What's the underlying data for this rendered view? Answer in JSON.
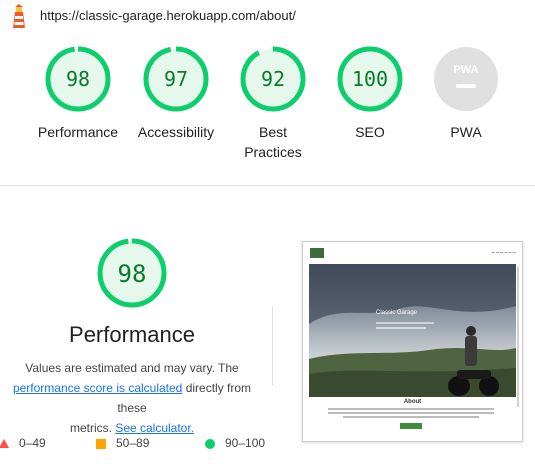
{
  "url": "https://classic-garage.herokuapp.com/about/",
  "gauges": [
    {
      "score": "98",
      "label": "Performance",
      "value": 98
    },
    {
      "score": "97",
      "label": "Accessibility",
      "value": 97
    },
    {
      "score": "92",
      "label": "Best Practices",
      "value": 92
    },
    {
      "score": "100",
      "label": "SEO",
      "value": 100
    },
    {
      "label": "PWA",
      "badge": "PWA"
    }
  ],
  "performance": {
    "score": "98",
    "title": "Performance",
    "desc_part1": "Values are estimated and may vary. The",
    "desc_link1": "performance score is calculated",
    "desc_part2": " directly from these",
    "desc_part3": "metrics. ",
    "desc_link2": "See calculator."
  },
  "legend": [
    {
      "range": "0–49",
      "shape": "triangle",
      "color": "#ff4e42"
    },
    {
      "range": "50–89",
      "shape": "square",
      "color": "#ffa400"
    },
    {
      "range": "90–100",
      "shape": "circle",
      "color": "#0cce6b"
    }
  ],
  "screenshot": {
    "hero_title": "Classic Garage",
    "about_heading": "About"
  },
  "colors": {
    "pass_ring": "#0cce6b",
    "pass_text": "#0a7a2a",
    "pass_fill": "#e6f7ec",
    "pwa_gray": "#e0e0e0",
    "link": "#1a73e8"
  }
}
